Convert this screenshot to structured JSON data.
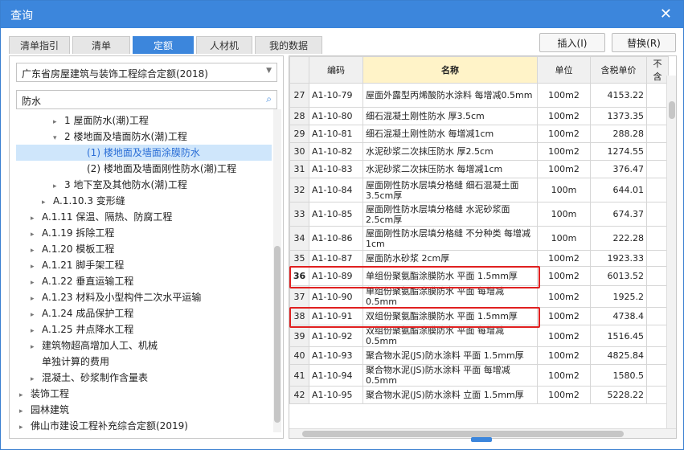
{
  "window": {
    "title": "查询",
    "close": "✕"
  },
  "tabs": [
    {
      "label": "清单指引",
      "active": false
    },
    {
      "label": "清单",
      "active": false
    },
    {
      "label": "定额",
      "active": true
    },
    {
      "label": "人材机",
      "active": false
    },
    {
      "label": "我的数据",
      "active": false
    }
  ],
  "actions": {
    "insert": "插入(I)",
    "replace": "替换(R)"
  },
  "left": {
    "quota_library": "广东省房屋建筑与装饰工程综合定额(2018)",
    "search_value": "防水",
    "tree": [
      {
        "label": "1 屋面防水(潮)工程",
        "indent": 4,
        "arrow": "▸"
      },
      {
        "label": "2 楼地面及墙面防水(潮)工程",
        "indent": 4,
        "arrow": "▾"
      },
      {
        "label": "(1) 楼地面及墙面涂膜防水",
        "indent": 6,
        "arrow": "",
        "selected": true
      },
      {
        "label": "(2) 楼地面及墙面刚性防水(潮)工程",
        "indent": 6,
        "arrow": ""
      },
      {
        "label": "3 地下室及其他防水(潮)工程",
        "indent": 4,
        "arrow": "▸"
      },
      {
        "label": "A.1.10.3 变形缝",
        "indent": 3,
        "arrow": "▸"
      },
      {
        "label": "A.1.11 保温、隔热、防腐工程",
        "indent": 2,
        "arrow": "▸"
      },
      {
        "label": "A.1.19 拆除工程",
        "indent": 2,
        "arrow": "▸"
      },
      {
        "label": "A.1.20 模板工程",
        "indent": 2,
        "arrow": "▸"
      },
      {
        "label": "A.1.21 脚手架工程",
        "indent": 2,
        "arrow": "▸"
      },
      {
        "label": "A.1.22 垂直运输工程",
        "indent": 2,
        "arrow": "▸"
      },
      {
        "label": "A.1.23 材料及小型构件二次水平运输",
        "indent": 2,
        "arrow": "▸"
      },
      {
        "label": "A.1.24 成品保护工程",
        "indent": 2,
        "arrow": "▸"
      },
      {
        "label": "A.1.25 井点降水工程",
        "indent": 2,
        "arrow": "▸"
      },
      {
        "label": "建筑物超高增加人工、机械",
        "indent": 2,
        "arrow": "▸"
      },
      {
        "label": "单独计算的费用",
        "indent": 2,
        "arrow": ""
      },
      {
        "label": "混凝土、砂浆制作含量表",
        "indent": 2,
        "arrow": "▸"
      },
      {
        "label": "装饰工程",
        "indent": 1,
        "arrow": "▸"
      },
      {
        "label": "园林建筑",
        "indent": 1,
        "arrow": "▸"
      },
      {
        "label": "佛山市建设工程补充综合定额(2019)",
        "indent": 1,
        "arrow": "▸"
      }
    ]
  },
  "grid": {
    "headers": [
      "",
      "编码",
      "名称",
      "单位",
      "含税单价",
      "不含"
    ],
    "rows": [
      {
        "idx": "27",
        "code": "A1-10-79",
        "name": "屋面外露型丙烯酸防水涂料 每增减0.5mm",
        "unit": "100m2",
        "price": "4153.22"
      },
      {
        "idx": "28",
        "code": "A1-10-80",
        "name": "细石混凝土刚性防水 厚3.5cm",
        "unit": "100m2",
        "price": "1373.35"
      },
      {
        "idx": "29",
        "code": "A1-10-81",
        "name": "细石混凝土刚性防水 每增减1cm",
        "unit": "100m2",
        "price": "288.28"
      },
      {
        "idx": "30",
        "code": "A1-10-82",
        "name": "水泥砂浆二次抹压防水 厚2.5cm",
        "unit": "100m2",
        "price": "1274.55"
      },
      {
        "idx": "31",
        "code": "A1-10-83",
        "name": "水泥砂浆二次抹压防水 每增减1cm",
        "unit": "100m2",
        "price": "376.47"
      },
      {
        "idx": "32",
        "code": "A1-10-84",
        "name": "屋面刚性防水层填分格缝 细石混凝土面3.5cm厚",
        "unit": "100m",
        "price": "644.01"
      },
      {
        "idx": "33",
        "code": "A1-10-85",
        "name": "屋面刚性防水层填分格缝 水泥砂浆面2.5cm厚",
        "unit": "100m",
        "price": "674.37"
      },
      {
        "idx": "34",
        "code": "A1-10-86",
        "name": "屋面刚性防水层填分格缝 不分种类 每增减1cm",
        "unit": "100m",
        "price": "222.28"
      },
      {
        "idx": "35",
        "code": "A1-10-87",
        "name": "屋面防水砂浆 2cm厚",
        "unit": "100m2",
        "price": "1923.33"
      },
      {
        "idx": "36",
        "code": "A1-10-89",
        "name": "单组份聚氨酯涂膜防水 平面 1.5mm厚",
        "unit": "100m2",
        "price": "6013.52",
        "current": true
      },
      {
        "idx": "37",
        "code": "A1-10-90",
        "name": "单组份聚氨酯涂膜防水 平面 每增减0.5mm",
        "unit": "100m2",
        "price": "1925.2"
      },
      {
        "idx": "38",
        "code": "A1-10-91",
        "name": "双组份聚氨酯涂膜防水 平面 1.5mm厚",
        "unit": "100m2",
        "price": "4738.4"
      },
      {
        "idx": "39",
        "code": "A1-10-92",
        "name": "双组份聚氨酯涂膜防水 平面 每增减0.5mm",
        "unit": "100m2",
        "price": "1516.45"
      },
      {
        "idx": "40",
        "code": "A1-10-93",
        "name": "聚合物水泥(JS)防水涂料 平面 1.5mm厚",
        "unit": "100m2",
        "price": "4825.84"
      },
      {
        "idx": "41",
        "code": "A1-10-94",
        "name": "聚合物水泥(JS)防水涂料 平面 每增减0.5mm",
        "unit": "100m2",
        "price": "1580.5"
      },
      {
        "idx": "42",
        "code": "A1-10-95",
        "name": "聚合物水泥(JS)防水涂料 立面 1.5mm厚",
        "unit": "100m2",
        "price": "5228.22"
      }
    ]
  },
  "colors": {
    "accent": "#3c86dc",
    "highlight": "#e02020",
    "header_name_bg": "#fff3c8"
  }
}
